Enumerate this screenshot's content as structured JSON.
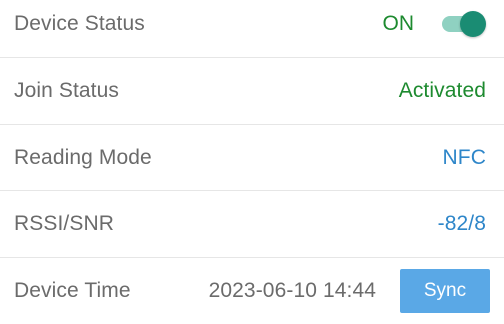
{
  "rows": [
    {
      "label": "Device Status",
      "value": "ON",
      "toggle_state": "on"
    },
    {
      "label": "Join Status",
      "value": "Activated"
    },
    {
      "label": "Reading Mode",
      "value": "NFC"
    },
    {
      "label": "RSSI/SNR",
      "value": "-82/8"
    },
    {
      "label": "Device Time",
      "value": "2023-06-10 14:44",
      "button_label": "Sync"
    }
  ],
  "colors": {
    "green_text": "#1d8a2f",
    "blue_text": "#2e86c9",
    "toggle_track": "#8fd1c1",
    "toggle_thumb": "#1a8c73",
    "sync_button": "#5aa8e6"
  }
}
